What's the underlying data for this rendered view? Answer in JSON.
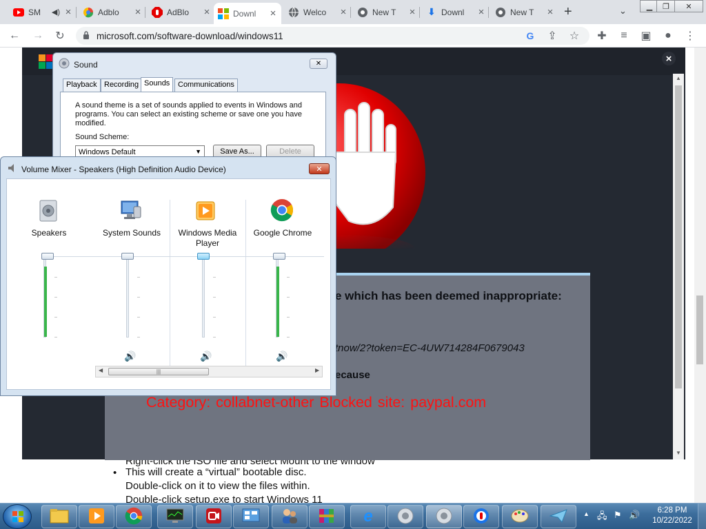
{
  "browser": {
    "tabs": [
      {
        "label": "SM",
        "icon": "youtube-icon"
      },
      {
        "label": "Adblo",
        "icon": "adblock-store-icon"
      },
      {
        "label": "AdBlo",
        "icon": "adblock-icon"
      },
      {
        "label": "Downl",
        "icon": "microsoft-icon",
        "active": true
      },
      {
        "label": "Welco",
        "icon": "globe-icon"
      },
      {
        "label": "New T",
        "icon": "chrome-icon"
      },
      {
        "label": "Downl",
        "icon": "download-icon"
      },
      {
        "label": "New T",
        "icon": "chrome-icon"
      }
    ],
    "url": "microsoft.com/software-download/windows11"
  },
  "sound_dialog": {
    "title": "Sound",
    "tabs": [
      "Playback",
      "Recording",
      "Sounds",
      "Communications"
    ],
    "active_tab": "Sounds",
    "description": "A sound theme is a set of sounds applied to events in Windows and programs.  You can select an existing scheme or save one you have modified.",
    "scheme_label": "Sound Scheme:",
    "scheme_value": "Windows Default",
    "save_as": "Save As...",
    "delete": "Delete"
  },
  "volume_mixer": {
    "title": "Volume Mixer - Speakers (High Definition Audio Device)",
    "channels": [
      {
        "label": "Speakers",
        "icon": "speakers-icon",
        "level": 1.0,
        "has_mute": false
      },
      {
        "label": "System Sounds",
        "icon": "system-sounds-icon",
        "level": 1.0,
        "has_mute": true
      },
      {
        "label": "Windows Media Player",
        "icon": "windows-media-player-icon",
        "level": 1.0,
        "has_mute": true
      },
      {
        "label": "Google Chrome",
        "icon": "chrome-icon",
        "level": 1.0,
        "has_mute": true
      }
    ]
  },
  "block_page": {
    "line1": "e which has been deemed inappropriate:",
    "line2": "tnow/2?token=EC-4UW714284F0679043",
    "line3": "ecause",
    "blocked_text": "Category: collabnet-other  Blocked site: paypal.com"
  },
  "page_below": {
    "partial_line": "Right-click the ISO file and select Mount to the window",
    "bullet": "This will create a “virtual” bootable disc.",
    "line2": "Double-click on it to view the files within.",
    "line3": "Double-click setup.exe to start Windows 11"
  },
  "taskbar": {
    "time": "6:28 PM",
    "date": "10/22/2022"
  },
  "colors": {
    "block_red": "#ff1111",
    "overlay_dark": "#242932",
    "taskbar_blue": "#3c6d9c"
  }
}
